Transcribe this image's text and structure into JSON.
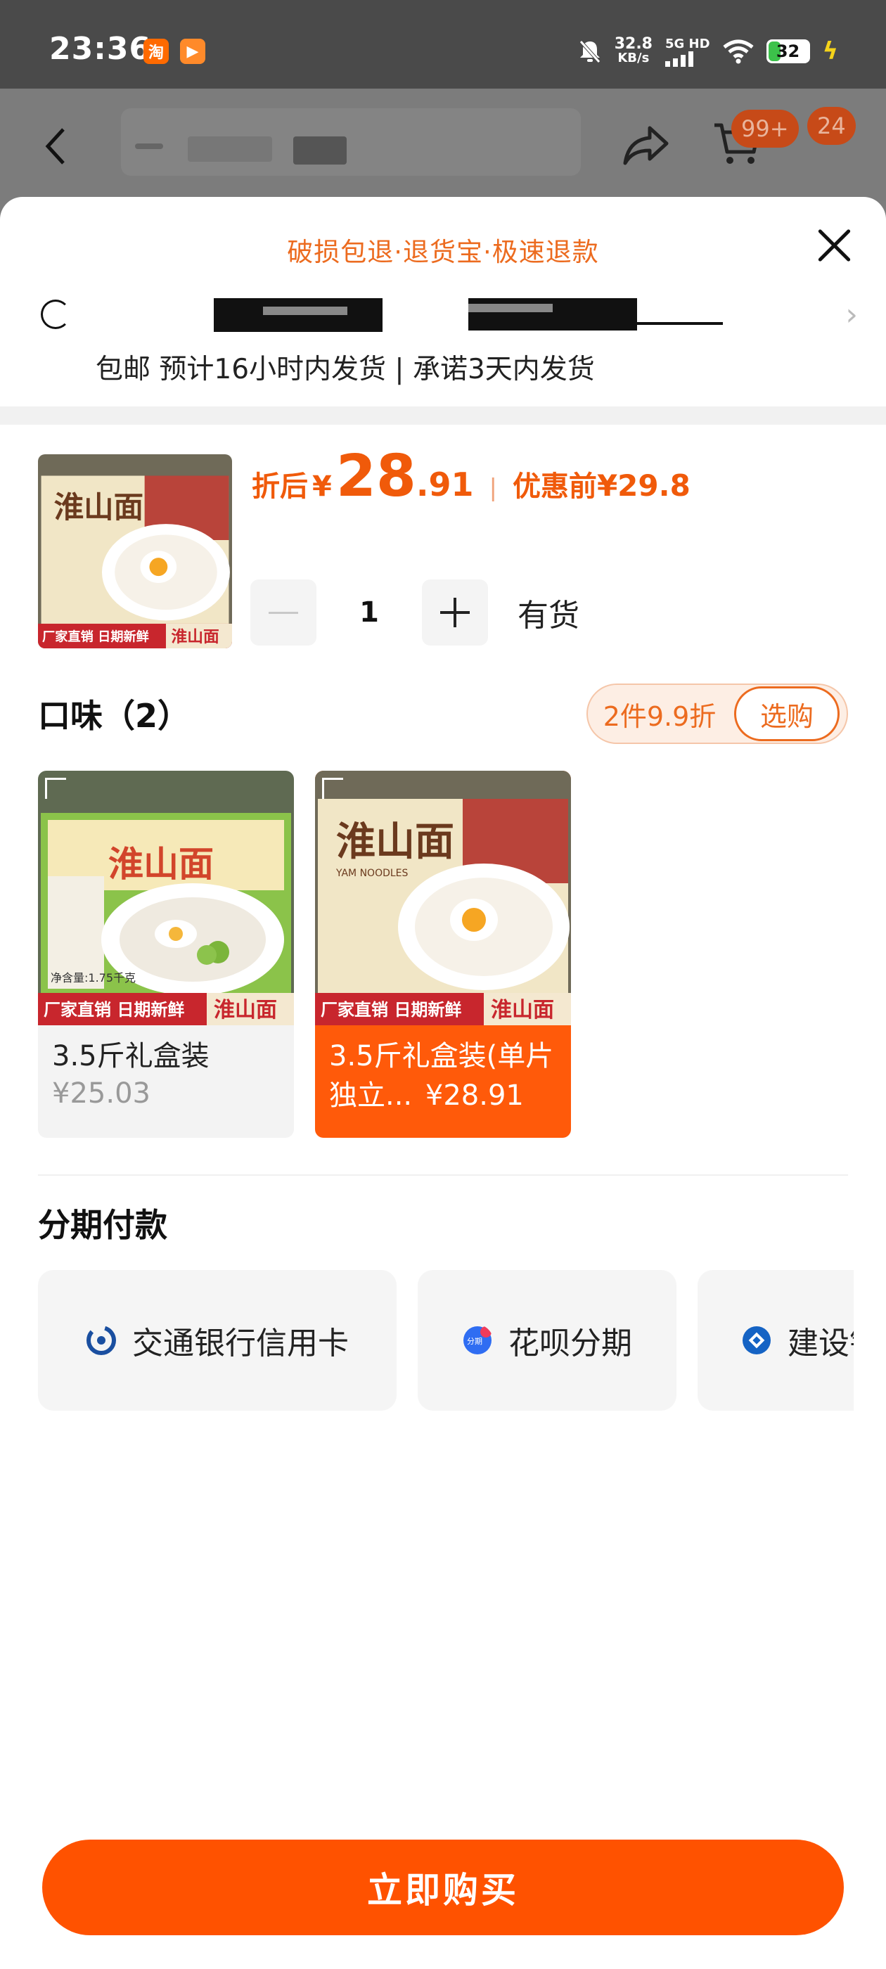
{
  "status_bar": {
    "time": "23:36",
    "apps": [
      "淘",
      "▶"
    ],
    "speed_value": "32.8",
    "speed_unit": "KB/s",
    "network": "5G HD",
    "battery": "32",
    "battery_level_pct": 32
  },
  "header": {
    "cart_badge": "99+",
    "message_badge": "24"
  },
  "sheet": {
    "promise_text": "破损包退·退货宝·极速退款",
    "shipping_text": "包邮 预计16小时内发货 | 承诺3天内发货",
    "price": {
      "after_label": "折后",
      "currency": "¥",
      "price_int": "28",
      "price_dec": ".91",
      "separator": "|",
      "before_label": "优惠前",
      "original_price": "¥29.8"
    },
    "quantity": "1",
    "stock_text": "有货",
    "flavor_section": {
      "title": "口味（2）",
      "promo_text": "2件9.9折",
      "promo_button": "选购",
      "options": [
        {
          "name": "3.5斤礼盒装",
          "price": "¥25.03",
          "selected": false,
          "badge_left": "厂家直销 日期新鲜",
          "badge_right": "淮山面",
          "box_title": "淮山面",
          "net_weight": "净含量:1.75千克"
        },
        {
          "name": "3.5斤礼盒装(单片独立...",
          "price": "¥28.91",
          "selected": true,
          "badge_left": "厂家直销 日期新鲜",
          "badge_right": "淮山面",
          "box_title": "淮山面",
          "box_sub": "YAM NOODLES"
        }
      ]
    },
    "installment": {
      "title": "分期付款",
      "options": [
        {
          "label": "交通银行信用卡",
          "icon": "bocom-icon"
        },
        {
          "label": "花呗分期",
          "icon": "huabei-icon",
          "icon_text": "分期"
        },
        {
          "label": "建设银",
          "icon": "ccb-icon"
        }
      ]
    },
    "buy_button": "立即购买"
  },
  "colors": {
    "accent": "#ff5200",
    "price": "#f05a0a",
    "promise": "#ec6b1f"
  }
}
